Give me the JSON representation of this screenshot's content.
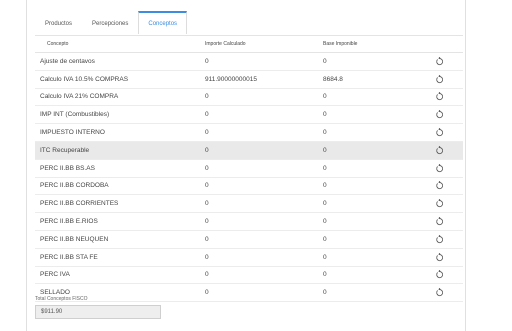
{
  "tabs": [
    {
      "label": "Productos",
      "active": false
    },
    {
      "label": "Percepciones",
      "active": false
    },
    {
      "label": "Conceptos",
      "active": true
    }
  ],
  "table": {
    "headers": {
      "concepto": "Concepto",
      "importe": "Importe Calculado",
      "base": "Base Imponible"
    },
    "rows": [
      {
        "concepto": "Ajuste de centavos",
        "importe": "0",
        "base": "0"
      },
      {
        "concepto": "Calculo IVA 10.5% COMPRAS",
        "importe": "911.90000000015",
        "base": "8684.8"
      },
      {
        "concepto": "Calculo IVA 21% COMPRA",
        "importe": "0",
        "base": "0"
      },
      {
        "concepto": "IMP INT (Combustibles)",
        "importe": "0",
        "base": "0"
      },
      {
        "concepto": "IMPUESTO INTERNO",
        "importe": "0",
        "base": "0"
      },
      {
        "concepto": "ITC Recuperable",
        "importe": "0",
        "base": "0"
      },
      {
        "concepto": "PERC II.BB BS.AS",
        "importe": "0",
        "base": "0"
      },
      {
        "concepto": "PERC II.BB CORDOBA",
        "importe": "0",
        "base": "0"
      },
      {
        "concepto": "PERC II.BB CORRIENTES",
        "importe": "0",
        "base": "0"
      },
      {
        "concepto": "PERC II.BB E.RIOS",
        "importe": "0",
        "base": "0"
      },
      {
        "concepto": "PERC II.BB NEUQUEN",
        "importe": "0",
        "base": "0"
      },
      {
        "concepto": "PERC II.BB STA FE",
        "importe": "0",
        "base": "0"
      },
      {
        "concepto": "PERC IVA",
        "importe": "0",
        "base": "0"
      },
      {
        "concepto": "SELLADO",
        "importe": "0",
        "base": "0"
      }
    ],
    "highlighted_row": 5,
    "row_action_icon": "reset-icon"
  },
  "total": {
    "label": "Total Conceptos FISCO",
    "value": "$911.90"
  },
  "colors": {
    "accent": "#3c8dde",
    "highlight": "#e9e9e9"
  }
}
